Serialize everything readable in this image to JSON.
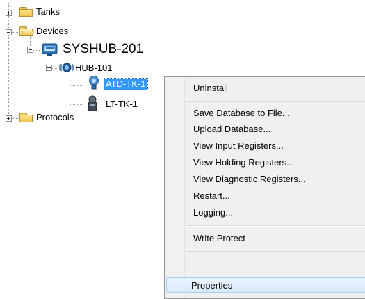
{
  "tree": {
    "tanks": "Tanks",
    "devices": "Devices",
    "syshub": "SYSHUB-201",
    "hub": "HUB-101",
    "atd": "ATD-TK-1",
    "lt": "LT-TK-1",
    "protocols": "Protocols"
  },
  "context_menu": {
    "items": [
      "Uninstall",
      "Save Database to File...",
      "Upload Database...",
      "View Input Registers...",
      "View Holding Registers...",
      "View Diagnostic Registers...",
      "Restart...",
      "Logging...",
      "Write Protect",
      "Properties"
    ],
    "highlighted": "Properties"
  },
  "colors": {
    "selection": "#3399ff",
    "menu_background": "#f0f0f0",
    "menu_hover": "#d9ebfb"
  }
}
